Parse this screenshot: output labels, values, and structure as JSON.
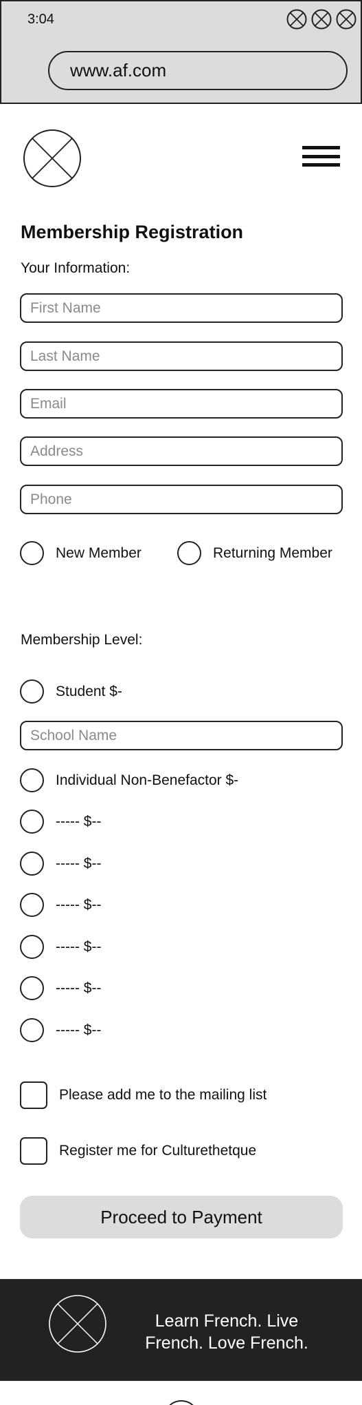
{
  "status_bar": {
    "time": "3:04"
  },
  "browser": {
    "url": "www.af.com"
  },
  "icons": {
    "window_buttons": [
      "close-icon",
      "close-icon",
      "close-icon"
    ],
    "logo": "logo-placeholder-icon",
    "menu": "hamburger-menu-icon"
  },
  "form": {
    "title": "Membership Registration",
    "info_label": "Your Information:",
    "fields": {
      "first_name": {
        "placeholder": "First Name"
      },
      "last_name": {
        "placeholder": "Last Name"
      },
      "email": {
        "placeholder": "Email"
      },
      "address": {
        "placeholder": "Address"
      },
      "phone": {
        "placeholder": "Phone"
      }
    },
    "member_type": {
      "new": "New Member",
      "returning": "Returning Member"
    },
    "level_label": "Membership Level:",
    "levels": {
      "student": "Student $-",
      "school_placeholder": "School Name",
      "individual": "Individual Non-Benefactor $-",
      "other": [
        "----- $--",
        "----- $--",
        "----- $--",
        "----- $--",
        "----- $--",
        "----- $--"
      ]
    },
    "mailing_list": "Please add me to the mailing list",
    "culturethetque": "Register me for Culturethetque",
    "submit": "Proceed to Payment"
  },
  "footer": {
    "tagline": "Learn French. Live French. Love French."
  },
  "colors": {
    "chrome_bg": "#dcdcdc",
    "footer_bg": "#222222",
    "button_bg": "#dcdcdc",
    "placeholder": "#8a8a8a"
  }
}
